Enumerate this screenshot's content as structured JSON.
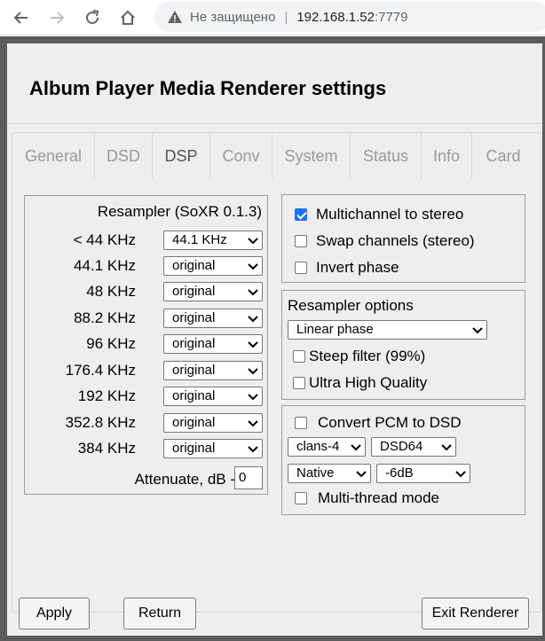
{
  "browser": {
    "insecure_label": "Не защищено",
    "url_host": "192.168.1.52",
    "url_port": ":7779"
  },
  "page": {
    "title": "Album Player Media Renderer settings"
  },
  "tabs": [
    {
      "label": "General",
      "active": false
    },
    {
      "label": "DSD",
      "active": false
    },
    {
      "label": "DSP",
      "active": true
    },
    {
      "label": "Conv",
      "active": false
    },
    {
      "label": "System",
      "active": false
    },
    {
      "label": "Status",
      "active": false
    },
    {
      "label": "Info",
      "active": false
    },
    {
      "label": "Card",
      "active": false
    }
  ],
  "resampler": {
    "title": "Resampler (SoXR 0.1.3)",
    "rates": [
      {
        "label": "< 44 KHz",
        "value": "44.1 KHz"
      },
      {
        "label": "44.1 KHz",
        "value": "original"
      },
      {
        "label": "48 KHz",
        "value": "original"
      },
      {
        "label": "88.2 KHz",
        "value": "original"
      },
      {
        "label": "96 KHz",
        "value": "original"
      },
      {
        "label": "176.4 KHz",
        "value": "original"
      },
      {
        "label": "192 KHz",
        "value": "original"
      },
      {
        "label": "352.8 KHz",
        "value": "original"
      },
      {
        "label": "384 KHz",
        "value": "original"
      }
    ],
    "attenuate_label": "Attenuate, dB -",
    "attenuate_value": "0"
  },
  "channel_options": {
    "multichannel_to_stereo": {
      "label": "Multichannel to stereo",
      "checked": true
    },
    "swap_channels": {
      "label": "Swap channels (stereo)",
      "checked": false
    },
    "invert_phase": {
      "label": "Invert phase",
      "checked": false
    }
  },
  "resampler_options": {
    "title": "Resampler options",
    "phase_select": "Linear phase",
    "steep_filter": {
      "label": "Steep filter (99%)",
      "checked": false
    },
    "ultra_high_quality": {
      "label": "Ultra High Quality",
      "checked": false
    }
  },
  "pcm_to_dsd": {
    "convert": {
      "label": "Convert PCM to DSD",
      "checked": false
    },
    "modulator_select": "clans-4",
    "rate_select": "DSD64",
    "mode_select": "Native",
    "gain_select": "-6dB",
    "multithread": {
      "label": "Multi-thread mode",
      "checked": false
    }
  },
  "buttons": {
    "apply": "Apply",
    "return": "Return",
    "exit": "Exit Renderer"
  },
  "colors": {
    "frame": "#5b5b5b",
    "panel": "#eeeeee",
    "checkbox_accent": "#1a73e8"
  }
}
